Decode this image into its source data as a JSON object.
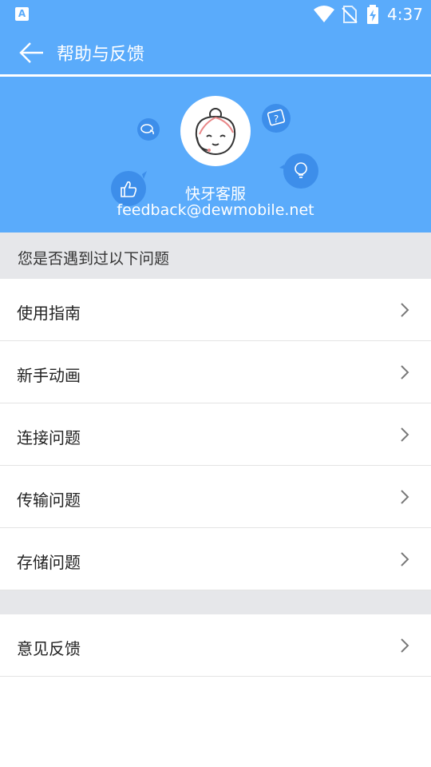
{
  "status_bar": {
    "notification_icon": "A",
    "time": "4:37",
    "icons": [
      "wifi-icon",
      "no-sim-icon",
      "battery-charging-icon"
    ]
  },
  "toolbar": {
    "title": "帮助与反馈",
    "back_icon": "arrow-left-icon"
  },
  "banner": {
    "name": "快牙客服",
    "email": "feedback@dewmobile.net",
    "colors": {
      "background": "#5AABFB",
      "bubble": "#3D8EEA"
    }
  },
  "section": {
    "header": "您是否遇到过以下问题"
  },
  "faq_items": [
    {
      "label": "使用指南"
    },
    {
      "label": "新手动画"
    },
    {
      "label": "连接问题"
    },
    {
      "label": "传输问题"
    },
    {
      "label": "存储问题"
    }
  ],
  "feedback_item": {
    "label": "意见反馈"
  },
  "colors": {
    "accent": "#5AABFB",
    "divider": "#E4E4E4",
    "section_bg": "#E6E7EA"
  }
}
